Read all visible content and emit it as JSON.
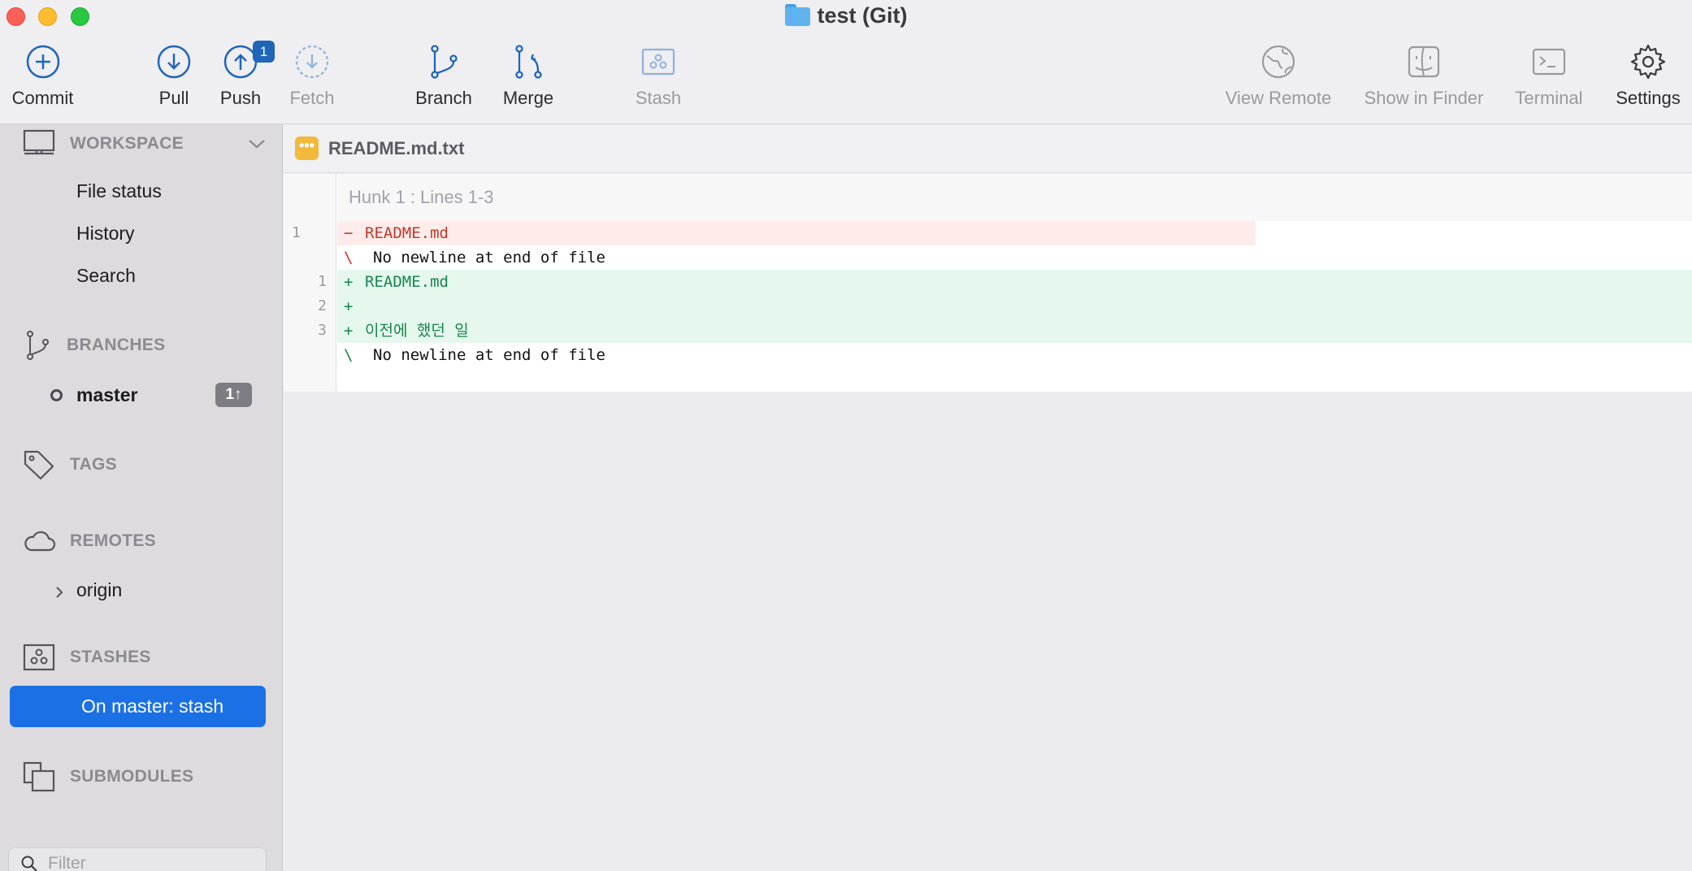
{
  "window": {
    "title": "test (Git)"
  },
  "toolbar": {
    "commit": "Commit",
    "pull": "Pull",
    "push": "Push",
    "push_badge": "1",
    "fetch": "Fetch",
    "branch": "Branch",
    "merge": "Merge",
    "stash": "Stash",
    "view_remote": "View Remote",
    "show_in_finder": "Show in Finder",
    "terminal": "Terminal",
    "settings": "Settings"
  },
  "sidebar": {
    "workspace": {
      "label": "WORKSPACE",
      "items": [
        "File status",
        "History",
        "Search"
      ]
    },
    "branches": {
      "label": "BRANCHES",
      "current": "master",
      "ahead": "1↑"
    },
    "tags": {
      "label": "TAGS"
    },
    "remotes": {
      "label": "REMOTES",
      "items": [
        "origin"
      ]
    },
    "stashes": {
      "label": "STASHES",
      "items": [
        "On master: stash"
      ]
    },
    "submodules": {
      "label": "SUBMODULES"
    },
    "filter": {
      "placeholder": "Filter"
    }
  },
  "diff": {
    "file_icon": "•••",
    "file_name": "README.md.txt",
    "hunk_header": "Hunk 1 : Lines 1-3",
    "lines": [
      {
        "type": "del",
        "old": "1",
        "new": "",
        "marker": "−",
        "text": "README.md"
      },
      {
        "type": "ctx",
        "old": "",
        "new": "",
        "marker": "\\",
        "text": "No newline at end of file"
      },
      {
        "type": "add",
        "old": "",
        "new": "1",
        "marker": "+",
        "text": "README.md"
      },
      {
        "type": "add",
        "old": "",
        "new": "2",
        "marker": "+",
        "text": ""
      },
      {
        "type": "add",
        "old": "",
        "new": "3",
        "marker": "+",
        "text": "이전에 했던 일"
      },
      {
        "type": "ctx",
        "old": "",
        "new": "",
        "marker": "\\",
        "text": "No newline at end of file"
      }
    ]
  },
  "colors": {
    "accent": "#1c70e6",
    "badge": "#1f66b8",
    "deleted_text": "#c0392b",
    "added_text": "#16864a",
    "deleted_bg": "#fdecea",
    "added_bg": "#e6f8ee"
  },
  "icons": {
    "commit": "plus-circle-icon",
    "pull": "arrow-down-circle-icon",
    "push": "arrow-up-circle-icon",
    "fetch": "dashed-arrow-down-circle-icon",
    "branch": "branch-icon",
    "merge": "merge-icon",
    "stash": "stash-box-icon",
    "view_remote": "globe-icon",
    "show_in_finder": "finder-icon",
    "terminal": "terminal-icon",
    "settings": "gear-icon"
  }
}
